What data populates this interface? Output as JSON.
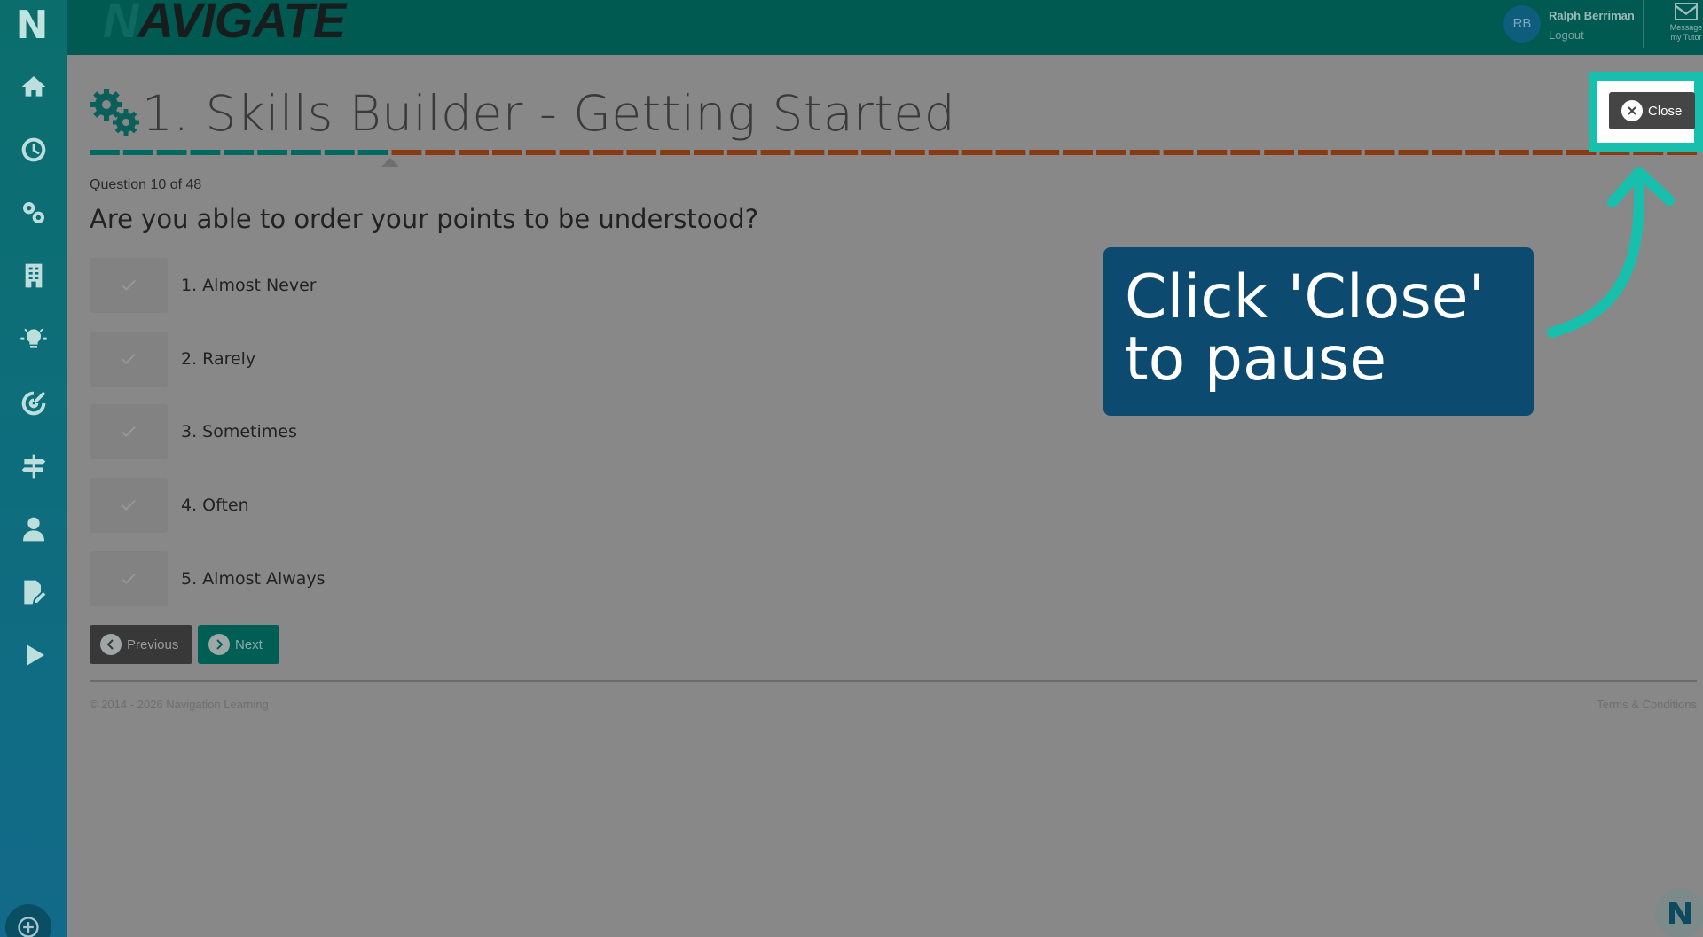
{
  "app": {
    "logo_letter": "N",
    "brand_prefix": "N",
    "brand_text": "AVIGATE"
  },
  "user": {
    "initials": "RB",
    "name": "Ralph Berriman",
    "logout_label": "Logout"
  },
  "message_tutor": {
    "line1": "Message",
    "line2": "my Tutor",
    "icon": "envelope-icon"
  },
  "sidebar": {
    "items": [
      {
        "icon": "home-icon"
      },
      {
        "icon": "clock-icon"
      },
      {
        "icon": "gears-icon"
      },
      {
        "icon": "building-icon"
      },
      {
        "icon": "lightbulb-icon"
      },
      {
        "icon": "target-icon"
      },
      {
        "icon": "signpost-icon"
      },
      {
        "icon": "user-icon"
      },
      {
        "icon": "edit-document-icon"
      },
      {
        "icon": "play-icon"
      }
    ],
    "bottom_icon": "add-circle-icon"
  },
  "page": {
    "title": "1. Skills Builder - Getting Started",
    "progress": {
      "current": 10,
      "total": 48,
      "completed_color": "#006a60",
      "remaining_color": "#8a3a10"
    },
    "question_counter": "Question 10 of 48",
    "question": "Are you able to order your points to be understood?",
    "answers": [
      {
        "label": "1. Almost Never"
      },
      {
        "label": "2. Rarely"
      },
      {
        "label": "3. Sometimes"
      },
      {
        "label": "4. Often"
      },
      {
        "label": "5. Almost Always"
      }
    ],
    "previous_label": "Previous",
    "next_label": "Next",
    "close_label": "Close"
  },
  "footer": {
    "copyright": "© 2014 - 2026 Navigation Learning",
    "terms": "Terms & Conditions"
  },
  "tutorial": {
    "callout_line1": "Click 'Close'",
    "callout_line2": "to pause",
    "highlight_color": "#17c0ad",
    "callout_color": "#0d4a70"
  }
}
